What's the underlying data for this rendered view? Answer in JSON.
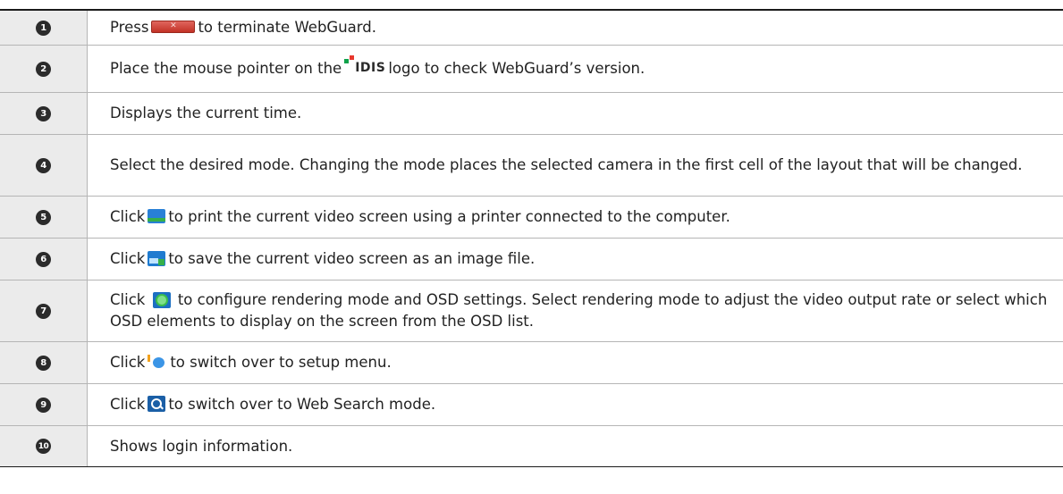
{
  "rows": [
    {
      "number": "1",
      "before": "Press",
      "icon": "close-button-icon",
      "after": "to terminate WebGuard."
    },
    {
      "number": "2",
      "before": "Place the mouse pointer on the",
      "icon": "idis-logo-icon",
      "icon_text": "IDIS",
      "after": "logo to check WebGuard’s version."
    },
    {
      "number": "3",
      "before": "Displays the current time.",
      "icon": "",
      "after": ""
    },
    {
      "number": "4",
      "before": "Select the desired mode. Changing the mode places the selected camera in the first cell of the layout that will be changed.",
      "icon": "",
      "after": ""
    },
    {
      "number": "5",
      "before": "Click",
      "icon": "print-icon",
      "after": "to print the current video screen using a printer connected to the computer."
    },
    {
      "number": "6",
      "before": "Click",
      "icon": "save-image-icon",
      "after": "to save the current video screen as an image file."
    },
    {
      "number": "7",
      "before": "Click",
      "icon": "settings-icon",
      "after": "to configure rendering mode and OSD settings. Select rendering mode to adjust the video output rate or select which OSD elements to display on the screen from the OSD list."
    },
    {
      "number": "8",
      "before": "Click",
      "icon": "setup-menu-icon",
      "after": "to switch over to setup menu."
    },
    {
      "number": "9",
      "before": "Click",
      "icon": "search-icon",
      "after": "to switch over to Web Search mode."
    },
    {
      "number": "10",
      "before": "Shows login information.",
      "icon": "",
      "after": ""
    }
  ],
  "colors": {
    "number_cell_bg": "#ebebeb",
    "badge_bg": "#2b2b2b",
    "border": "#b5b5b5"
  }
}
